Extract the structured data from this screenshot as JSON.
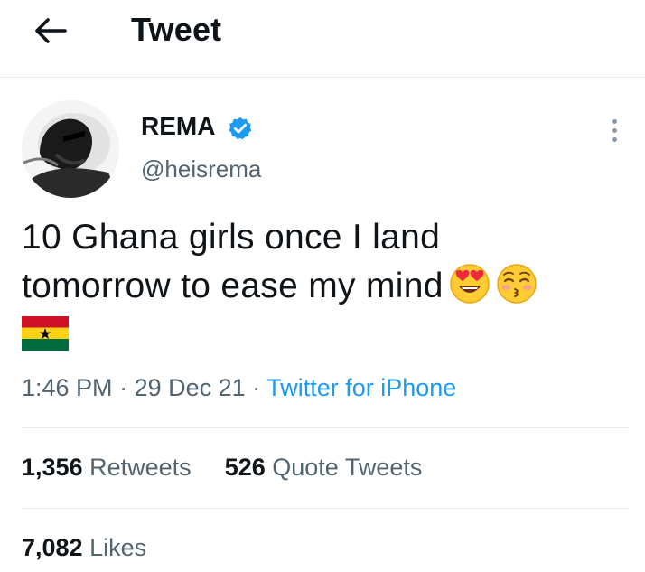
{
  "header": {
    "title": "Tweet",
    "back_icon": "arrow-left-icon"
  },
  "author": {
    "display_name": "REMA",
    "handle": "@heisrema",
    "verified": true,
    "verified_color": "#1d9bf0"
  },
  "tweet": {
    "line1": "10 Ghana girls once I land",
    "line2": "tomorrow to ease my mind",
    "emojis": [
      "heart-eyes-emoji",
      "kissing-closed-eyes-emoji",
      "ghana-flag-emoji"
    ]
  },
  "meta": {
    "time": "1:46 PM",
    "date": "29 Dec 21",
    "separator": "·",
    "source": "Twitter for iPhone"
  },
  "stats": {
    "retweets_count": "1,356",
    "retweets_label": "Retweets",
    "quotes_count": "526",
    "quotes_label": "Quote Tweets",
    "likes_count": "7,082",
    "likes_label": "Likes"
  },
  "colors": {
    "text": "#0f1419",
    "secondary": "#536471",
    "accent": "#1d9bf0",
    "divider": "#e6e9ec"
  }
}
